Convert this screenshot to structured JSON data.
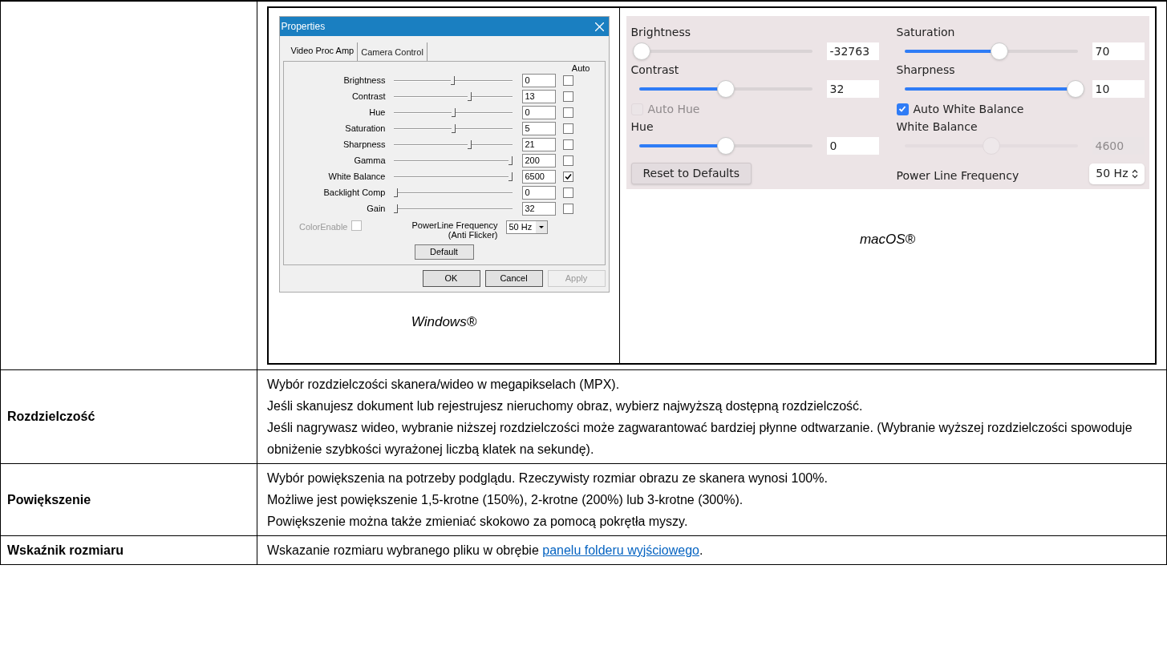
{
  "windows_dialog": {
    "title": "Properties",
    "tabs": [
      {
        "label": "Video Proc Amp",
        "selected": true
      },
      {
        "label": "Camera Control",
        "selected": false
      }
    ],
    "auto_header": "Auto",
    "rows": [
      {
        "label": "Brightness",
        "level": 0.5,
        "value": "0",
        "auto": false
      },
      {
        "label": "Contrast",
        "level": 0.65,
        "value": "13",
        "auto": false
      },
      {
        "label": "Hue",
        "level": 0.51,
        "value": "0",
        "auto": false
      },
      {
        "label": "Saturation",
        "level": 0.51,
        "value": "5",
        "auto": false
      },
      {
        "label": "Sharpness",
        "level": 0.65,
        "value": "21",
        "auto": false
      },
      {
        "label": "Gamma",
        "level": 1,
        "value": "200",
        "auto": false
      },
      {
        "label": "White Balance",
        "level": 1,
        "value": "6500",
        "auto": true
      },
      {
        "label": "Backlight Comp",
        "level": 0,
        "value": "0",
        "auto": false
      },
      {
        "label": "Gain",
        "level": 0,
        "value": "32",
        "auto": false
      }
    ],
    "color_enable": {
      "label": "ColorEnable",
      "checked": false,
      "disabled": true
    },
    "powerline": {
      "label": "PowerLine Frequency",
      "sublabel": "(Anti Flicker)",
      "value": "50 Hz"
    },
    "default_button": "Default",
    "buttons": [
      {
        "label": "OK",
        "disabled": false
      },
      {
        "label": "Cancel",
        "disabled": false
      },
      {
        "label": "Apply",
        "disabled": true
      }
    ],
    "caption": "Windows®"
  },
  "macos_panel": {
    "columns": [
      [
        {
          "kind": "slider",
          "label": "Brightness",
          "level": 0,
          "value": "-32763",
          "disabled": false
        },
        {
          "kind": "slider",
          "label": "Contrast",
          "level": 0.5,
          "value": "32",
          "disabled": false
        },
        {
          "kind": "checkbox",
          "label": "Auto Hue",
          "checked": false,
          "disabled": true
        },
        {
          "kind": "slider",
          "label": "Hue",
          "level": 0.5,
          "value": "0",
          "disabled": false
        },
        {
          "kind": "button",
          "label": "Reset to Defaults"
        }
      ],
      [
        {
          "kind": "slider",
          "label": "Saturation",
          "level": 0.55,
          "value": "70",
          "disabled": false
        },
        {
          "kind": "slider",
          "label": "Sharpness",
          "level": 1,
          "value": "10",
          "disabled": false
        },
        {
          "kind": "checkbox",
          "label": "Auto White Balance",
          "checked": true,
          "disabled": false
        },
        {
          "kind": "slider",
          "label": "White Balance",
          "level": 0.5,
          "value": "4600",
          "disabled": true
        },
        {
          "kind": "select",
          "label": "Power Line Frequency",
          "value": "50 Hz"
        }
      ]
    ],
    "caption": "macOS®"
  },
  "rows": [
    {
      "label": "Rozdzielczość",
      "paragraphs": [
        [
          {
            "text": "Wybór rozdzielczości skanera/wideo w megapikselach (MPX)."
          }
        ],
        [
          {
            "text": "Jeśli skanujesz dokument lub rejestrujesz nieruchomy obraz, wybierz najwyższą dostępną rozdzielczość."
          }
        ],
        [
          {
            "text": "Jeśli nagrywasz wideo, wybranie niższej rozdzielczości może zagwarantować bardziej płynne odtwarzanie. (Wybranie wyższej rozdzielczości spowoduje obniżenie szybkości wyrażonej liczbą klatek na sekundę)."
          }
        ]
      ]
    },
    {
      "label": "Powiększenie",
      "paragraphs": [
        [
          {
            "text": "Wybór powiększenia na potrzeby podglądu. Rzeczywisty rozmiar obrazu ze skanera wynosi 100%."
          }
        ],
        [
          {
            "text": "Możliwe jest powiększenie 1,5-krotne (150%), 2-krotne (200%) lub 3-krotne (300%)."
          }
        ],
        [
          {
            "text": "Powiększenie można także zmieniać skokowo za pomocą pokrętła myszy."
          }
        ]
      ]
    },
    {
      "label": "Wskaźnik rozmiaru",
      "paragraphs": [
        [
          {
            "text": "Wskazanie rozmiaru wybranego pliku w obrębie "
          },
          {
            "text": "panelu folderu wyjściowego",
            "kind": "link"
          },
          {
            "text": "."
          }
        ]
      ]
    }
  ]
}
